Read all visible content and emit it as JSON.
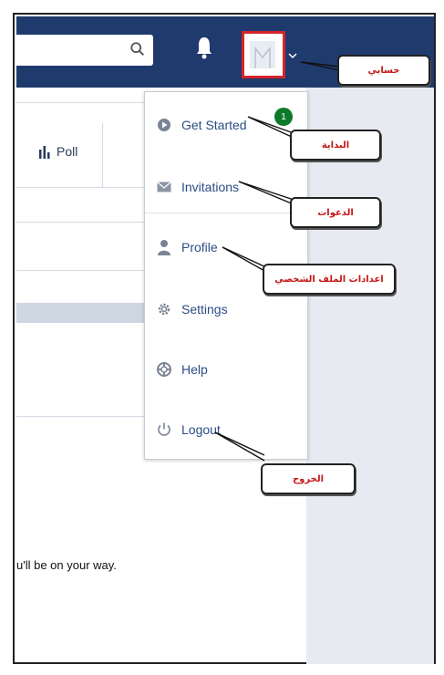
{
  "toolbar": {
    "search_icon": "search-icon",
    "bell_icon": "bell-icon",
    "avatar_icon": "avatar-icon",
    "chevron_icon": "chevron-down-icon",
    "notification_count": "1"
  },
  "content": {
    "poll_label": "Poll",
    "bottom_text": "u'll be on your way."
  },
  "menu": {
    "items": [
      {
        "label": "Get Started",
        "icon": "play-circle-icon"
      },
      {
        "label": "Invitations",
        "icon": "envelope-icon"
      },
      {
        "label": "Profile",
        "icon": "person-icon"
      },
      {
        "label": "Settings",
        "icon": "gear-icon"
      },
      {
        "label": "Help",
        "icon": "lifebuoy-icon"
      },
      {
        "label": "Logout",
        "icon": "power-icon"
      }
    ]
  },
  "callouts": {
    "account": "حسابي",
    "start": "البداية",
    "invitations": "الدعوات",
    "profile_settings": "اعدادات الملف الشخصي",
    "logout": "الخروج"
  },
  "colors": {
    "topbar": "#1f3a6d",
    "highlight": "#d8232a",
    "link": "#2b4d85",
    "badge": "#0d7a2a",
    "callout_text": "#c51616"
  }
}
